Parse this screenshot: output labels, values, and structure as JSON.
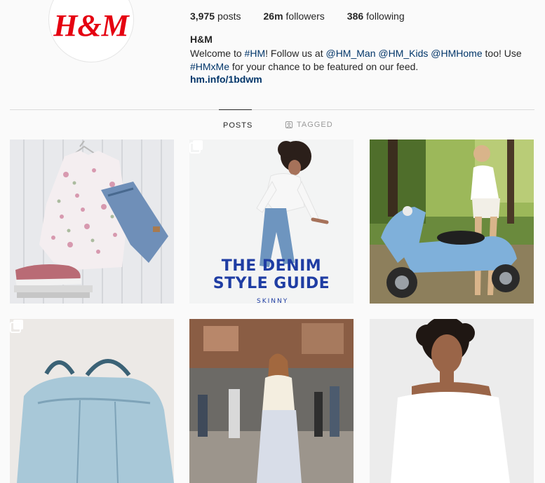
{
  "profile": {
    "logo_text": "H&M",
    "stats": {
      "posts_count": "3,975",
      "posts_label": "posts",
      "followers_count": "26m",
      "followers_label": "followers",
      "following_count": "386",
      "following_label": "following"
    },
    "full_name": "H&M",
    "bio": {
      "part1": "Welcome to ",
      "hashtag1": "#HM",
      "part2": "! Follow us at ",
      "mention1": "@HM_Man",
      "space1": " ",
      "mention2": "@HM_Kids",
      "space2": " ",
      "mention3": "@HMHome",
      "part3": " too! Use ",
      "hashtag2": "#HMxMe",
      "part4": " for your chance to be featured on our feed."
    },
    "website": "hm.info/1bdwm"
  },
  "tabs": {
    "posts": "POSTS",
    "tagged": "TAGGED"
  },
  "posts": {
    "post2_text_line1": "THE DENIM",
    "post2_text_line2": "STYLE GUIDE",
    "post2_subtext": "SKINNY"
  },
  "colors": {
    "brand_red": "#e50010",
    "link_blue": "#003569",
    "denim_blue": "#1f3da3"
  }
}
